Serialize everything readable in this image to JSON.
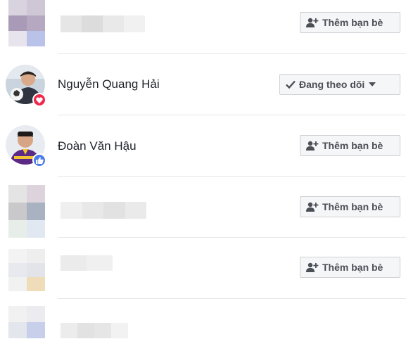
{
  "friends": [
    {
      "name": "Nguyễn Quang Hải",
      "action": "Đang theo dõi",
      "badge": "heart-reaction"
    },
    {
      "name": "Đoàn Văn Hậu",
      "action": "Thêm bạn bè",
      "badge": "like-reaction"
    }
  ],
  "add_friend_label": "Thêm bạn bè",
  "following_label": "Đang theo dõi",
  "icons": {
    "add_friend": "person-plus-icon",
    "check": "check-icon",
    "dropdown": "caret-down-icon"
  },
  "colors": {
    "button_bg": "#f5f6f7",
    "button_border": "#ced0d4",
    "button_text": "#4b4f56",
    "love_badge": "#f0284a",
    "like_badge": "#4b7bec"
  }
}
